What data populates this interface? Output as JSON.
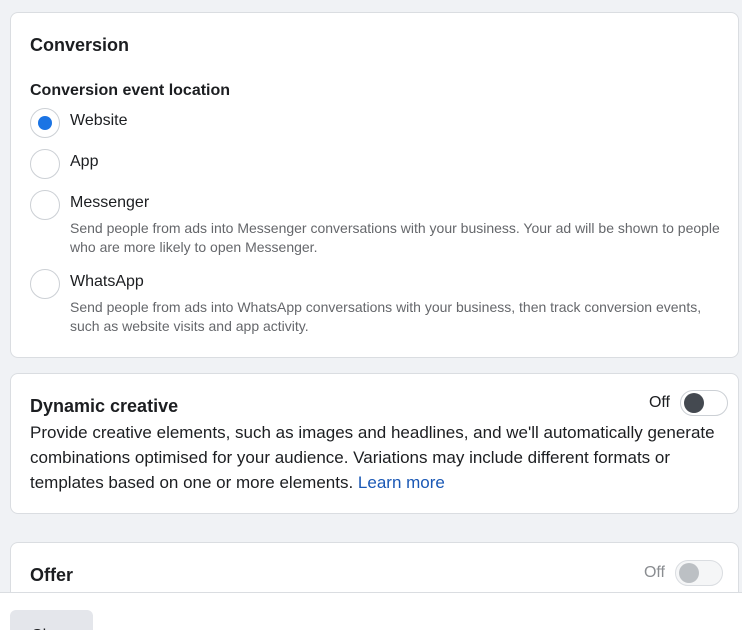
{
  "conversion": {
    "title": "Conversion",
    "location_heading": "Conversion event location",
    "options": [
      {
        "label": "Website",
        "selected": true,
        "description": ""
      },
      {
        "label": "App",
        "selected": false,
        "description": ""
      },
      {
        "label": "Messenger",
        "selected": false,
        "description": "Send people from ads into Messenger conversations with your business. Your ad will be shown to people who are more likely to open Messenger."
      },
      {
        "label": "WhatsApp",
        "selected": false,
        "description": "Send people from ads into WhatsApp conversations with your business, then track conversion events, such as website visits and app activity."
      }
    ]
  },
  "dynamic_creative": {
    "title": "Dynamic creative",
    "toggle_label": "Off",
    "toggle_on": false,
    "description": "Provide creative elements, such as images and headlines, and we'll automatically generate combinations optimised for your audience. Variations may include different formats or templates based on one or more elements.",
    "learn_more": "Learn more"
  },
  "offer": {
    "title": "Offer",
    "toggle_label": "Off",
    "toggle_on": false,
    "disabled": true
  },
  "footer": {
    "close_label": "Close"
  },
  "colors": {
    "accent": "#1b74e4",
    "link": "#1a58b5",
    "background": "#f0f2f5"
  }
}
